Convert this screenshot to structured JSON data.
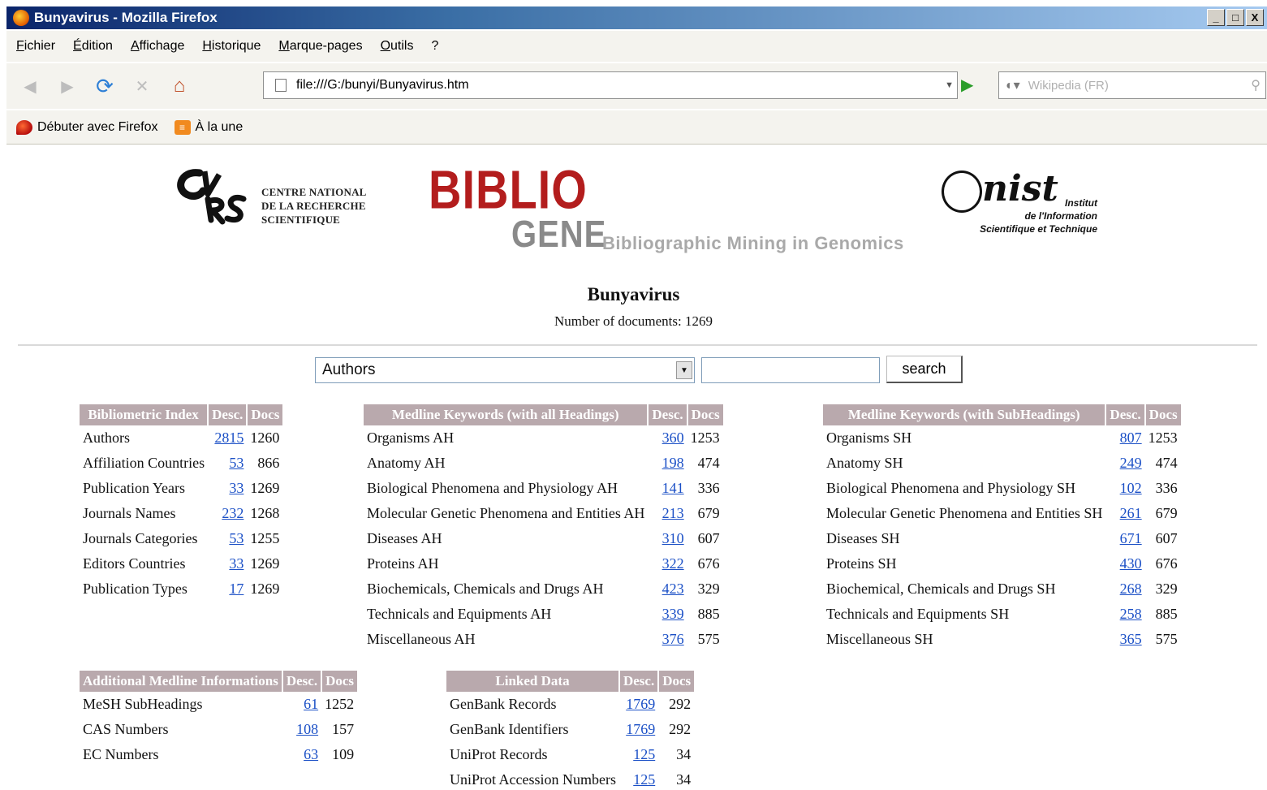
{
  "window": {
    "title": "Bunyavirus - Mozilla Firefox",
    "controls": [
      "_",
      "□",
      "X"
    ]
  },
  "menu": [
    "Fichier",
    "Édition",
    "Affichage",
    "Historique",
    "Marque-pages",
    "Outils",
    "?"
  ],
  "toolbar": {
    "url": "file:///G:/bunyi/Bunyavirus.htm",
    "search_placeholder": "Wikipedia (FR)"
  },
  "bookmarks": [
    "Débuter avec Firefox",
    "À la une"
  ],
  "header": {
    "cnrs_lines": [
      "CENTRE NATIONAL",
      "DE LA RECHERCHE",
      "SCIENTIFIQUE"
    ],
    "biblio_top": "BIBLIO",
    "biblio_gene": "GENE",
    "biblio_sub": "Bibliographic Mining in Genomics",
    "inist_mark": "nist",
    "inist_lines": [
      "Institut",
      "de l'Information",
      "Scientifique et Technique"
    ]
  },
  "page": {
    "title": "Bunyavirus",
    "doc_count": "Number of documents: 1269"
  },
  "search": {
    "field": "Authors",
    "query": "",
    "button": "search"
  },
  "tables": {
    "biblio": {
      "headers": [
        "Bibliometric Index",
        "Desc.",
        "Docs"
      ],
      "rows": [
        {
          "name": "Authors",
          "desc": "2815",
          "docs": "1260"
        },
        {
          "name": "Affiliation Countries",
          "desc": "53",
          "docs": "866"
        },
        {
          "name": "Publication Years",
          "desc": "33",
          "docs": "1269"
        },
        {
          "name": "Journals Names",
          "desc": "232",
          "docs": "1268"
        },
        {
          "name": "Journals Categories",
          "desc": "53",
          "docs": "1255"
        },
        {
          "name": "Editors Countries",
          "desc": "33",
          "docs": "1269"
        },
        {
          "name": "Publication Types",
          "desc": "17",
          "docs": "1269"
        }
      ]
    },
    "medall": {
      "headers": [
        "Medline Keywords (with all Headings)",
        "Desc.",
        "Docs"
      ],
      "rows": [
        {
          "name": "Organisms AH",
          "desc": "360",
          "docs": "1253"
        },
        {
          "name": "Anatomy AH",
          "desc": "198",
          "docs": "474"
        },
        {
          "name": "Biological Phenomena and Physiology AH",
          "desc": "141",
          "docs": "336"
        },
        {
          "name": "Molecular Genetic Phenomena and Entities AH",
          "desc": "213",
          "docs": "679"
        },
        {
          "name": "Diseases AH",
          "desc": "310",
          "docs": "607"
        },
        {
          "name": "Proteins AH",
          "desc": "322",
          "docs": "676"
        },
        {
          "name": "Biochemicals, Chemicals and Drugs AH",
          "desc": "423",
          "docs": "329"
        },
        {
          "name": "Technicals and Equipments AH",
          "desc": "339",
          "docs": "885"
        },
        {
          "name": "Miscellaneous AH",
          "desc": "376",
          "docs": "575"
        }
      ]
    },
    "medsub": {
      "headers": [
        "Medline Keywords (with SubHeadings)",
        "Desc.",
        "Docs"
      ],
      "rows": [
        {
          "name": "Organisms SH",
          "desc": "807",
          "docs": "1253"
        },
        {
          "name": "Anatomy SH",
          "desc": "249",
          "docs": "474"
        },
        {
          "name": "Biological Phenomena and Physiology SH",
          "desc": "102",
          "docs": "336"
        },
        {
          "name": "Molecular Genetic Phenomena and Entities SH",
          "desc": "261",
          "docs": "679"
        },
        {
          "name": "Diseases SH",
          "desc": "671",
          "docs": "607"
        },
        {
          "name": "Proteins SH",
          "desc": "430",
          "docs": "676"
        },
        {
          "name": "Biochemical, Chemicals and Drugs SH",
          "desc": "268",
          "docs": "329"
        },
        {
          "name": "Technicals and Equipments SH",
          "desc": "258",
          "docs": "885"
        },
        {
          "name": "Miscellaneous SH",
          "desc": "365",
          "docs": "575"
        }
      ]
    },
    "addl": {
      "headers": [
        "Additional Medline Informations",
        "Desc.",
        "Docs"
      ],
      "rows": [
        {
          "name": "MeSH SubHeadings",
          "desc": "61",
          "docs": "1252"
        },
        {
          "name": "CAS Numbers",
          "desc": "108",
          "docs": "157"
        },
        {
          "name": "EC Numbers",
          "desc": "63",
          "docs": "109"
        }
      ]
    },
    "linked": {
      "headers": [
        "Linked Data",
        "Desc.",
        "Docs"
      ],
      "rows": [
        {
          "name": "GenBank Records",
          "desc": "1769",
          "docs": "292"
        },
        {
          "name": "GenBank Identifiers",
          "desc": "1769",
          "docs": "292"
        },
        {
          "name": "UniProt Records",
          "desc": "125",
          "docs": "34"
        },
        {
          "name": "UniProt Accession Numbers",
          "desc": "125",
          "docs": "34"
        }
      ]
    }
  }
}
